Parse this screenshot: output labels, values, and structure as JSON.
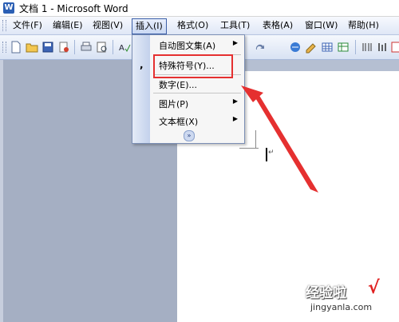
{
  "window": {
    "title": "文档 1 - Microsoft Word",
    "icon": "word-document-icon"
  },
  "menubar": {
    "items": [
      "文件(F)",
      "编辑(E)",
      "视图(V)",
      "插入(I)",
      "格式(O)",
      "工具(T)",
      "表格(A)",
      "窗口(W)",
      "帮助(H)"
    ],
    "active": "插入(I)"
  },
  "toolbar": {
    "icons": [
      "new-document-icon",
      "open-folder-icon",
      "save-icon",
      "permission-icon",
      "print-icon",
      "print-preview-icon",
      "spelling-icon",
      "undo-icon",
      "redo-icon",
      "hyperlink-icon",
      "tables-borders-icon",
      "insert-table-icon",
      "insert-excel-icon",
      "columns-icon",
      "drawing-icon",
      "show-hide-icon"
    ]
  },
  "insert_menu": {
    "items": [
      {
        "label": "自动图文集(A)",
        "submenu": true
      },
      {
        "label": "特殊符号(Y)...",
        "submenu": false,
        "highlighted": true
      },
      {
        "label": "数字(E)...",
        "submenu": false
      },
      {
        "label": "图片(P)",
        "submenu": true
      },
      {
        "label": "文本框(X)",
        "submenu": true
      }
    ],
    "expand_icon": "chevron-double-down-icon"
  },
  "annotation": {
    "highlight_color": "#e53030",
    "arrow_color": "#e53030"
  },
  "watermark": {
    "line1": "经验啦",
    "line2": "jingyanla.com",
    "check": "√"
  },
  "colors": {
    "menubar": "#dfe7f6",
    "left_pane": "#a5afc3",
    "page": "#ffffff"
  }
}
